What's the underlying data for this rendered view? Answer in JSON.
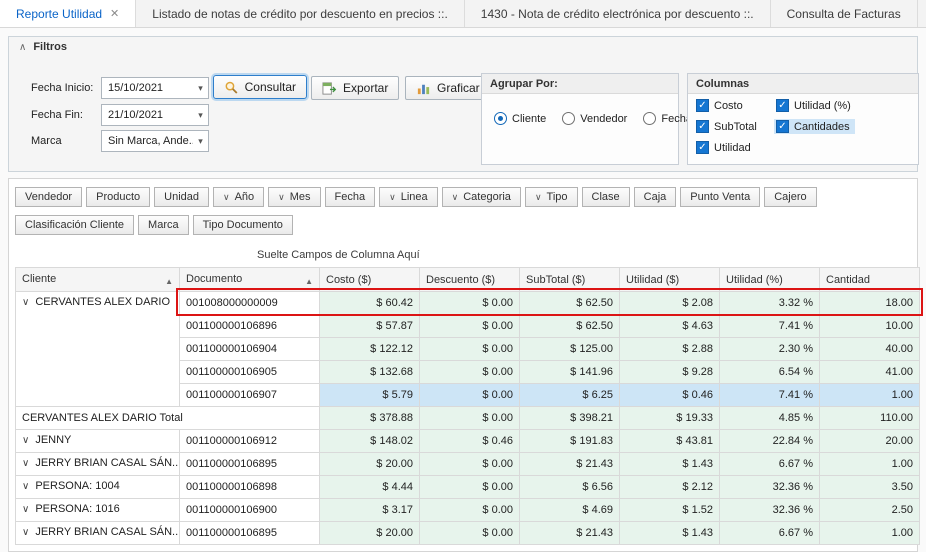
{
  "tabs": [
    {
      "label": "Reporte Utilidad",
      "active": true
    },
    {
      "label": "Listado de notas de crédito por descuento en precios ::.",
      "active": false
    },
    {
      "label": "1430 - Nota de crédito electrónica por descuento ::.",
      "active": false
    },
    {
      "label": "Consulta de Facturas",
      "active": false
    }
  ],
  "filters": {
    "title": "Filtros",
    "fields": {
      "fecha_inicio": {
        "label": "Fecha Inicio:",
        "value": "15/10/2021"
      },
      "fecha_fin": {
        "label": "Fecha Fin:",
        "value": "21/10/2021"
      },
      "marca": {
        "label": "Marca",
        "value": "Sin Marca, Ande..."
      }
    },
    "actions": {
      "consultar": "Consultar",
      "exportar": "Exportar",
      "graficar": "Graficar"
    },
    "agrupar_por": {
      "title": "Agrupar Por:",
      "options": [
        {
          "label": "Cliente",
          "selected": true
        },
        {
          "label": "Vendedor",
          "selected": false
        },
        {
          "label": "Fecha",
          "selected": false
        }
      ]
    },
    "columnas": {
      "title": "Columnas",
      "options": [
        {
          "label": "Costo",
          "checked": true,
          "col": 0,
          "highlighted": false
        },
        {
          "label": "SubTotal",
          "checked": true,
          "col": 0,
          "highlighted": false
        },
        {
          "label": "Utilidad",
          "checked": true,
          "col": 0,
          "highlighted": false
        },
        {
          "label": "Utilidad (%)",
          "checked": true,
          "col": 1,
          "highlighted": false
        },
        {
          "label": "Cantidades",
          "checked": true,
          "col": 1,
          "highlighted": true
        }
      ]
    }
  },
  "pivot": {
    "drop_hint": "Suelte Campos de Columna Aquí",
    "field_buttons_row1": [
      {
        "label": "Vendedor",
        "arrow": false
      },
      {
        "label": "Producto",
        "arrow": false
      },
      {
        "label": "Unidad",
        "arrow": false
      },
      {
        "label": "Año",
        "arrow": true
      },
      {
        "label": "Mes",
        "arrow": true
      },
      {
        "label": "Fecha",
        "arrow": false
      },
      {
        "label": "Linea",
        "arrow": true
      },
      {
        "label": "Categoria",
        "arrow": true
      },
      {
        "label": "Tipo",
        "arrow": true
      },
      {
        "label": "Clase",
        "arrow": false
      },
      {
        "label": "Caja",
        "arrow": false
      },
      {
        "label": "Punto Venta",
        "arrow": false
      },
      {
        "label": "Cajero",
        "arrow": false
      }
    ],
    "field_buttons_row2": [
      {
        "label": "Clasificación Cliente",
        "arrow": false
      },
      {
        "label": "Marca",
        "arrow": false
      },
      {
        "label": "Tipo Documento",
        "arrow": false
      }
    ]
  },
  "grid": {
    "columns": [
      {
        "label": "Cliente",
        "sort": "asc"
      },
      {
        "label": "Documento",
        "sort": "asc"
      },
      {
        "label": "Costo ($)",
        "sort": null
      },
      {
        "label": "Descuento ($)",
        "sort": null
      },
      {
        "label": "SubTotal ($)",
        "sort": null
      },
      {
        "label": "Utilidad ($)",
        "sort": null
      },
      {
        "label": "Utilidad (%)",
        "sort": null
      },
      {
        "label": "Cantidad",
        "sort": null
      }
    ],
    "rows": [
      {
        "cliente": "CERVANTES ALEX DARIO",
        "cliente_rowspan": 5,
        "documento": "001008000000009",
        "values": [
          "$ 60.42",
          "$ 0.00",
          "$ 62.50",
          "$ 2.08",
          "3.32 %",
          "18.00"
        ],
        "red_highlight": true
      },
      {
        "documento": "001100000106896",
        "values": [
          "$ 57.87",
          "$ 0.00",
          "$ 62.50",
          "$ 4.63",
          "7.41 %",
          "10.00"
        ]
      },
      {
        "documento": "001100000106904",
        "values": [
          "$ 122.12",
          "$ 0.00",
          "$ 125.00",
          "$ 2.88",
          "2.30 %",
          "40.00"
        ]
      },
      {
        "documento": "001100000106905",
        "values": [
          "$ 132.68",
          "$ 0.00",
          "$ 141.96",
          "$ 9.28",
          "6.54 %",
          "41.00"
        ]
      },
      {
        "documento": "001100000106907",
        "selected": true,
        "values": [
          "$ 5.79",
          "$ 0.00",
          "$ 6.25",
          "$ 0.46",
          "7.41 %",
          "1.00"
        ]
      },
      {
        "total": true,
        "total_label": "CERVANTES ALEX DARIO Total",
        "values": [
          "$ 378.88",
          "$ 0.00",
          "$ 398.21",
          "$ 19.33",
          "4.85 %",
          "110.00"
        ]
      },
      {
        "cliente": "JENNY",
        "cliente_rowspan": 1,
        "documento": "001100000106912",
        "values": [
          "$ 148.02",
          "$ 0.46",
          "$ 191.83",
          "$ 43.81",
          "22.84 %",
          "20.00"
        ]
      },
      {
        "cliente": "JERRY BRIAN CASAL SÁN...",
        "cliente_rowspan": 1,
        "documento": "001100000106895",
        "values": [
          "$ 20.00",
          "$ 0.00",
          "$ 21.43",
          "$ 1.43",
          "6.67 %",
          "1.00"
        ]
      },
      {
        "cliente": "PERSONA: 1004",
        "cliente_rowspan": 1,
        "documento": "001100000106898",
        "values": [
          "$ 4.44",
          "$ 0.00",
          "$ 6.56",
          "$ 2.12",
          "32.36 %",
          "3.50"
        ]
      },
      {
        "cliente": "PERSONA: 1016",
        "cliente_rowspan": 1,
        "documento": "001100000106900",
        "values": [
          "$ 3.17",
          "$ 0.00",
          "$ 4.69",
          "$ 1.52",
          "32.36 %",
          "2.50"
        ]
      },
      {
        "cliente": "JERRY BRIAN CASAL SÁN...",
        "cliente_rowspan": 1,
        "documento": "001100000106895",
        "values": [
          "$ 20.00",
          "$ 0.00",
          "$ 21.43",
          "$ 1.43",
          "6.67 %",
          "1.00"
        ]
      }
    ]
  },
  "annotation": {
    "color": "#dc1414"
  }
}
